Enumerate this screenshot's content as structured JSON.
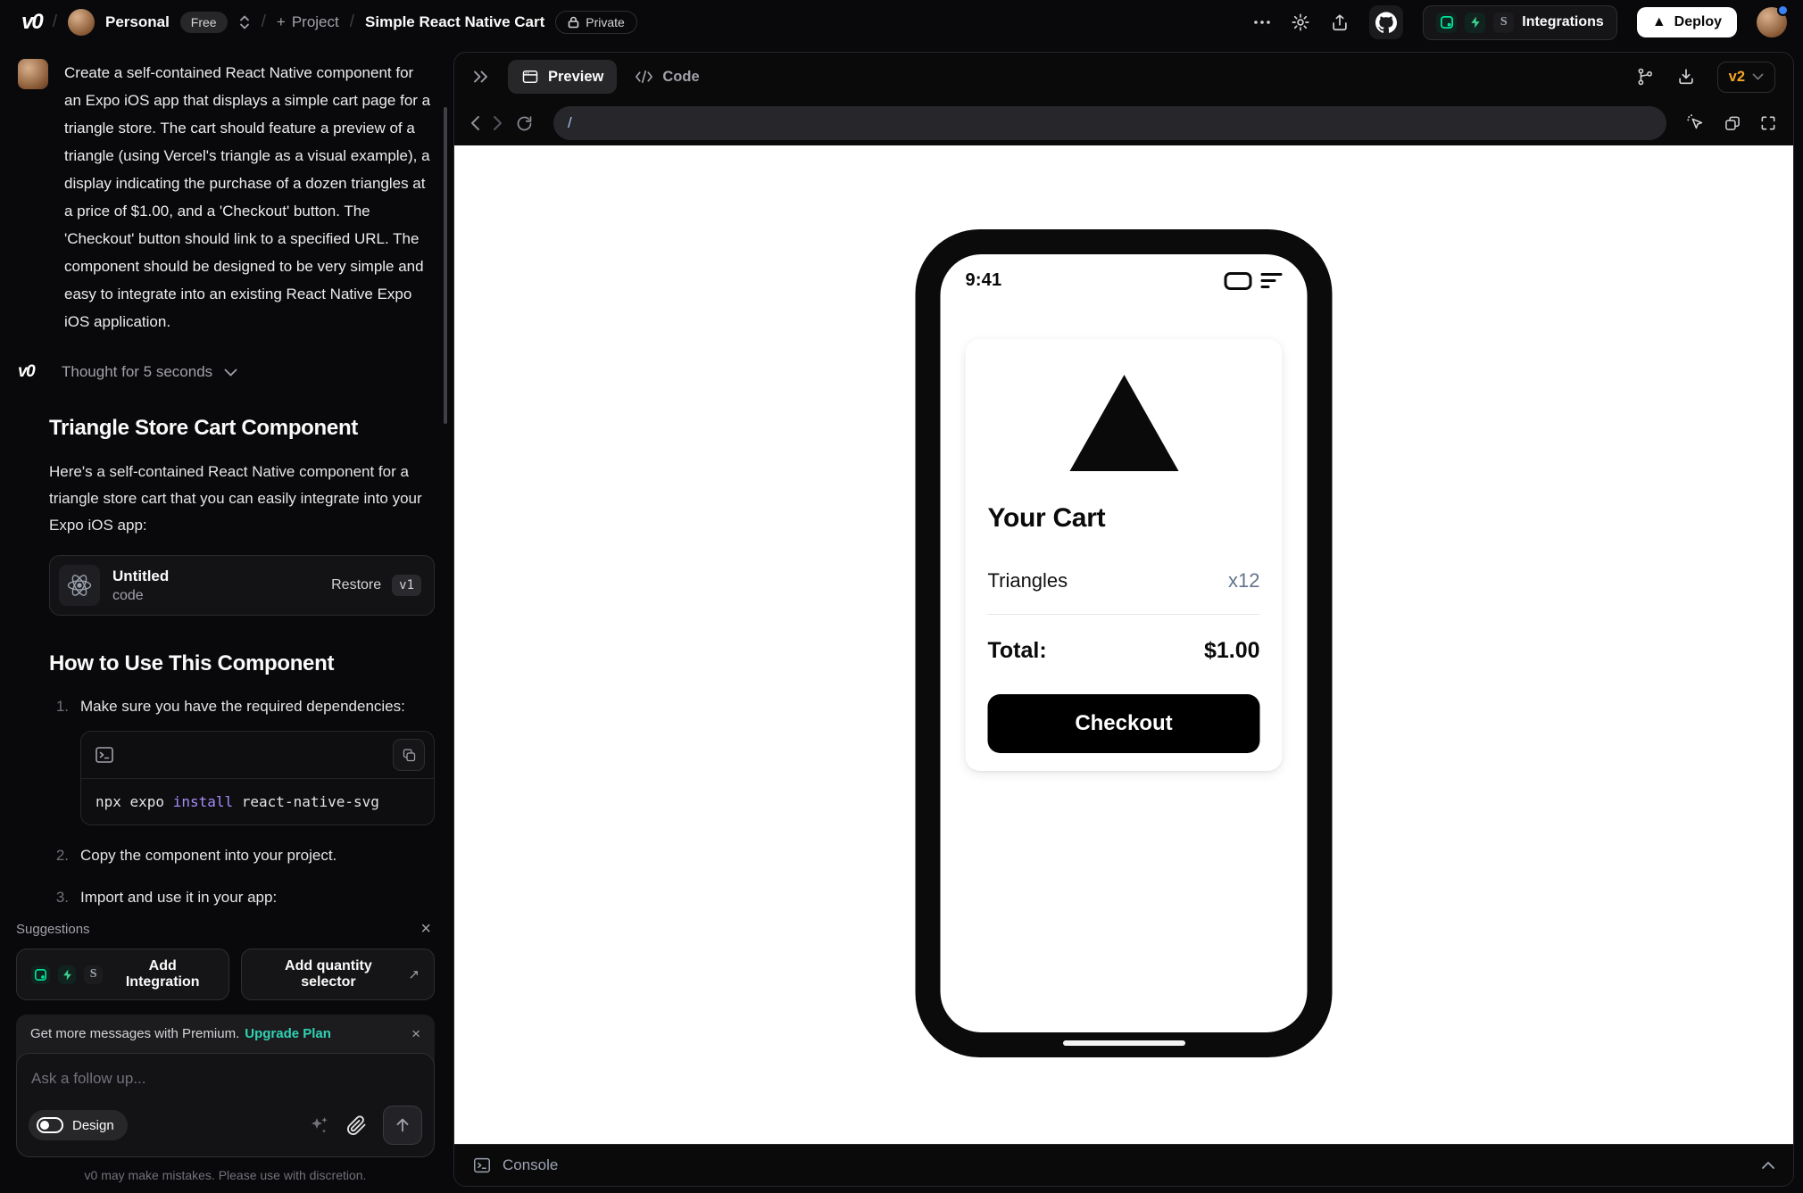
{
  "header": {
    "brand": "v0",
    "workspace": {
      "name": "Personal",
      "plan_badge": "Free"
    },
    "project_label": "Project",
    "chat_title": "Simple React Native Cart",
    "privacy_badge": "Private",
    "integrations_label": "Integrations",
    "deploy_label": "Deploy"
  },
  "icons": {
    "separator": "/",
    "plus": "+",
    "close": "×",
    "external_arrow": "↗",
    "deploy_triangle": "▲",
    "stripe_s": "S"
  },
  "chat": {
    "user_message": "Create a self-contained React Native component for an Expo iOS app that displays a simple cart page for a triangle store. The cart should feature a preview of a triangle (using Vercel's triangle as a visual example), a display indicating the purchase of a dozen triangles at a price of $1.00, and a 'Checkout' button. The 'Checkout' button should link to a specified URL. The component should be designed to be very simple and easy to integrate into an existing React Native Expo iOS application.",
    "thought_label": "Thought for 5 seconds",
    "response": {
      "heading1": "Triangle Store Cart Component",
      "intro": "Here's a self-contained React Native component for a triangle store cart that you can easily integrate into your Expo iOS app:",
      "code_card": {
        "title": "Untitled",
        "subtitle": "code",
        "restore_label": "Restore",
        "version": "v1"
      },
      "heading2": "How to Use This Component",
      "steps": [
        {
          "num": "1.",
          "text": "Make sure you have the required dependencies:"
        },
        {
          "num": "2.",
          "text": "Copy the component into your project."
        },
        {
          "num": "3.",
          "text": "Import and use it in your app:"
        }
      ],
      "code_snippet": {
        "tokens": [
          "npx expo ",
          "install",
          " react-native-svg"
        ]
      }
    },
    "suggestions": {
      "label": "Suggestions",
      "items": [
        {
          "label": "Add Integration"
        },
        {
          "label": "Add quantity selector"
        }
      ]
    },
    "premium_banner": {
      "text": "Get more messages with Premium.",
      "link": "Upgrade Plan"
    },
    "composer": {
      "placeholder": "Ask a follow up...",
      "design_label": "Design"
    },
    "disclaimer": "v0 may make mistakes. Please use with discretion."
  },
  "preview": {
    "tabs": {
      "preview": "Preview",
      "code": "Code"
    },
    "version_selector": "v2",
    "url": "/",
    "console_label": "Console",
    "phone": {
      "time": "9:41",
      "cart": {
        "title": "Your Cart",
        "item_name": "Triangles",
        "item_qty": "x12",
        "total_label": "Total:",
        "total_value": "$1.00",
        "checkout_label": "Checkout"
      }
    }
  },
  "colors": {
    "accent_teal": "#31d2b3",
    "version_amber": "#f5a623",
    "code_purple": "#a78bfa",
    "url_slash_blue": "#a8c4f2",
    "notification_blue": "#3b82f6",
    "supabase_green": "#3ecf8e",
    "neon_teal": "#00e599"
  }
}
